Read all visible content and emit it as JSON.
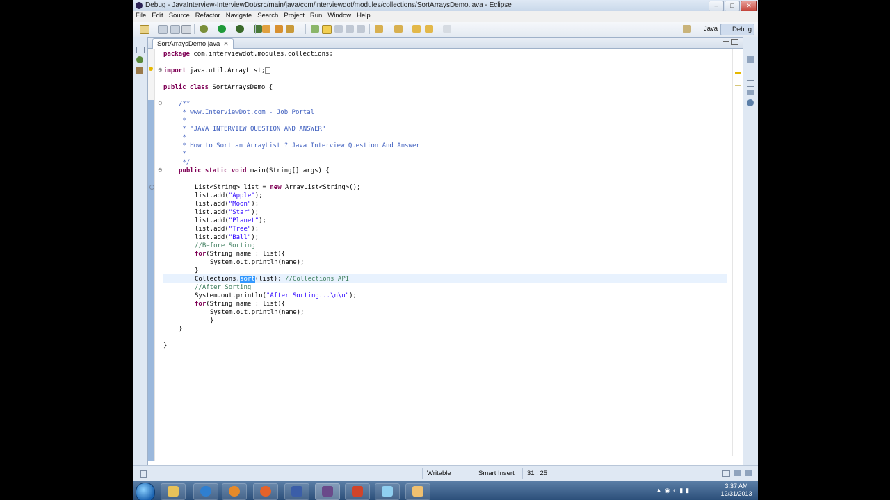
{
  "window": {
    "title": "Debug - JavaInterview-InterviewDot/src/main/java/com/interviewdot/modules/collections/SortArraysDemo.java - Eclipse",
    "controls": {
      "minimize": "–",
      "maximize": "□",
      "close": "✕"
    }
  },
  "menu": [
    "File",
    "Edit",
    "Source",
    "Refactor",
    "Navigate",
    "Search",
    "Project",
    "Run",
    "Window",
    "Help"
  ],
  "perspectives": {
    "java": "Java",
    "debug": "Debug"
  },
  "editor": {
    "tab_label": "SortArraysDemo.java",
    "tab_close": "✕",
    "lines": {
      "package_kw": "package",
      "package_name": " com.interviewdot.modules.collections;",
      "import_kw": "import",
      "import_name": " java.util.ArrayList;",
      "class_kw": "public class",
      "class_rest": " SortArraysDemo {",
      "c1": "/**",
      "c2": " * www.InterviewDot.com - Job Portal",
      "c3": " *",
      "c4": " * \"JAVA INTERVIEW QUESTION AND ANSWER\"",
      "c5": " *",
      "c6": " * How to Sort an ArrayList ? Java Interview Question And Answer",
      "c7": " *",
      "c8": " */",
      "main_kw": "public static void",
      "main_rest": " main(String[] args) {",
      "list_decl_a": "List<String> list = ",
      "list_decl_kw": "new",
      "list_decl_b": " ArrayList<String>();",
      "add1_a": "list.add(",
      "add1_s": "\"Apple\"",
      "add1_b": ");",
      "add2_a": "list.add(",
      "add2_s": "\"Moon\"",
      "add2_b": ");",
      "add3_a": "list.add(",
      "add3_s": "\"Star\"",
      "add3_b": ");",
      "add4_a": "list.add(",
      "add4_s": "\"Planet\"",
      "add4_b": ");",
      "add5_a": "list.add(",
      "add5_s": "\"Tree\"",
      "add5_b": ");",
      "add6_a": "list.add(",
      "add6_s": "\"Ball\"",
      "add6_b": ");",
      "before_cmt": "//Before Sorting",
      "for1_kw": "for",
      "for1_rest": "(String name : list){",
      "print1": "System.out.println(name);",
      "close1": "}",
      "sort_a": "Collections.",
      "sort_sel": "sort",
      "sort_b": "(list); ",
      "sort_cmt": "//Collections API",
      "after_cmt": "//After Sorting",
      "print_after_a": "System.out.println(",
      "print_after_s": "\"After Sorting...\\n\\n\"",
      "print_after_b": ");",
      "for2_kw": "for",
      "for2_rest": "(String name : list){",
      "print2": "System.out.println(name);",
      "close2": "}",
      "close_main": "}",
      "close_class": "}"
    }
  },
  "status": {
    "writable": "Writable",
    "insert_mode": "Smart Insert",
    "position": "31 : 25"
  },
  "taskbar": {
    "time": "3:37 AM",
    "date": "12/31/2013"
  },
  "colors": {
    "keyword": "#7f0055",
    "string": "#2a00ff",
    "comment": "#3f7f5f",
    "javadoc": "#3f5fbf",
    "selection": "#3399ff"
  }
}
